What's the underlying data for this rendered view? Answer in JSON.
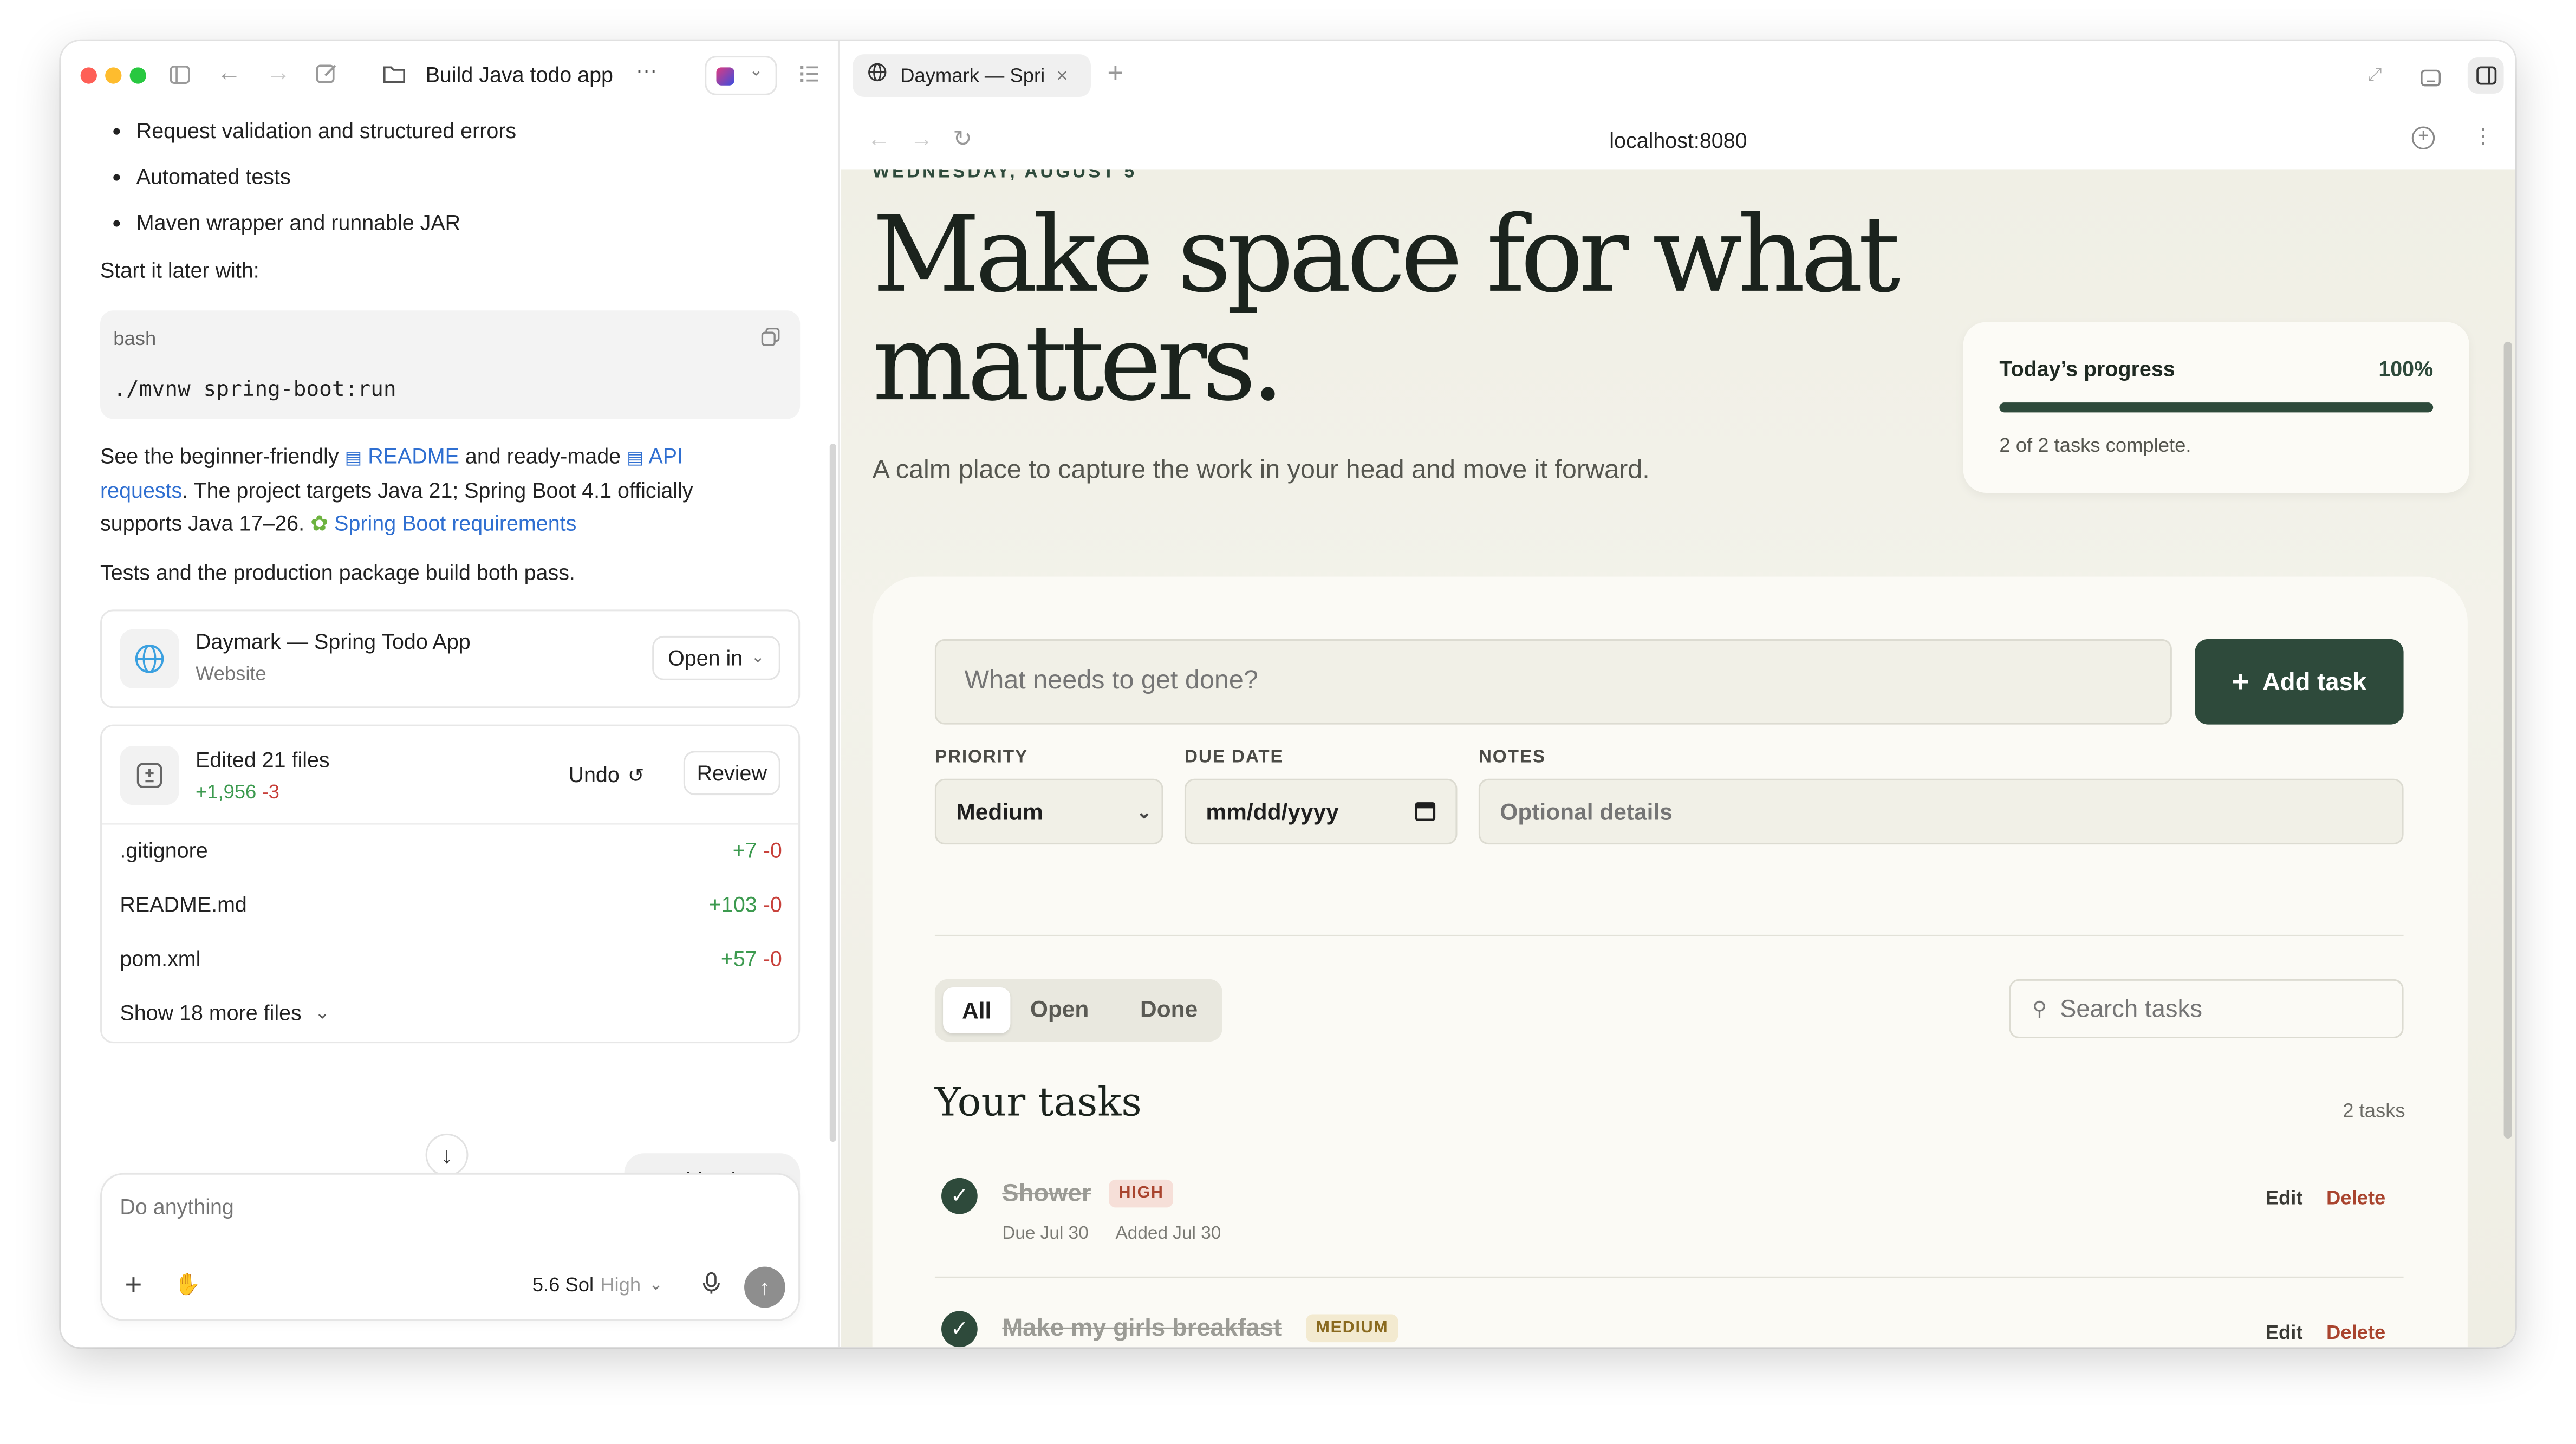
{
  "left_pane": {
    "window_title": "Build Java todo app",
    "more_label": "···",
    "bullets": [
      "Request validation and structured errors",
      "Automated tests",
      "Maven wrapper and runnable JAR"
    ],
    "start_text": "Start it later with:",
    "code_lang": "bash",
    "code_text": "./mvnw spring-boot:run",
    "para1_pre": "See the beginner-friendly",
    "para1_readme": "README",
    "para1_mid": "and ready-made",
    "para1_api_1": "API",
    "para1_api_2": "requests",
    "para1_post": ". The project targets Java 21; Spring Boot 4.1 officially",
    "para1_line3": "supports Java 17–26.",
    "para1_springlink": "Spring Boot requirements",
    "para2": "Tests and the production package build both pass.",
    "site_card": {
      "title": "Daymark — Spring Todo App",
      "subtitle": "Website",
      "open_label": "Open in"
    },
    "edits": {
      "title": "Edited 21 files",
      "added": "+1,956",
      "removed": "-3",
      "undo_label": "Undo",
      "review_label": "Review",
      "files": [
        {
          "name": ".gitignore",
          "added": "+7",
          "removed": "-0"
        },
        {
          "name": "README.md",
          "added": "+103",
          "removed": "-0"
        },
        {
          "name": "pom.xml",
          "added": "+57",
          "removed": "-0"
        }
      ],
      "show_more": "Show 18 more files"
    },
    "user_message": "run this please",
    "composer": {
      "placeholder": "Do anything",
      "model": "5.6 Sol",
      "effort": "High"
    }
  },
  "browser": {
    "tab_title": "Daymark — Spri",
    "url": "localhost:8080"
  },
  "app": {
    "date": "WEDNESDAY, AUGUST 5",
    "headline_1": "Make space for what",
    "headline_2": "matters.",
    "subtitle": "A calm place to capture the work in your head and move it forward.",
    "progress": {
      "label": "Today’s progress",
      "percent_label": "100%",
      "fraction": 1.0,
      "summary": "2 of 2 tasks complete."
    },
    "form": {
      "task_placeholder": "What needs to get done?",
      "add_label": "Add task",
      "priority_label": "PRIORITY",
      "priority_value": "Medium",
      "due_label": "DUE DATE",
      "due_placeholder": "mm/dd/yyyy",
      "notes_label": "NOTES",
      "notes_placeholder": "Optional details"
    },
    "filters": [
      "All",
      "Open",
      "Done"
    ],
    "search_placeholder": "Search tasks",
    "list_title": "Your tasks",
    "task_count": "2 tasks",
    "tasks": [
      {
        "title": "Shower",
        "priority": "HIGH",
        "due": "Due Jul 30",
        "added": "Added Jul 30",
        "edit": "Edit",
        "delete": "Delete"
      },
      {
        "title": "Make my girls breakfast",
        "priority": "MEDIUM",
        "edit": "Edit",
        "delete": "Delete"
      }
    ]
  },
  "colors": {
    "accent": "#2e4a3b",
    "delete": "#a9442e",
    "link": "#2f6fd1"
  }
}
